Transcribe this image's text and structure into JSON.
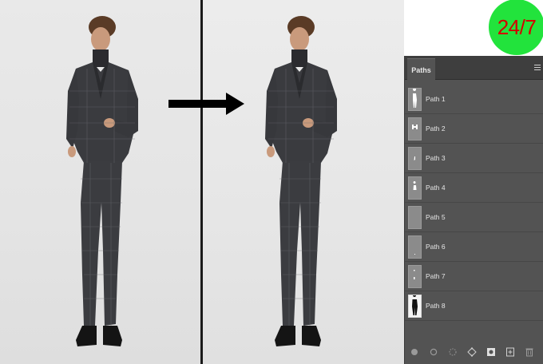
{
  "badge": {
    "text": "24/7",
    "color": "#22e33c",
    "text_color": "#d40000"
  },
  "panel": {
    "tab_label": "Paths",
    "paths": [
      {
        "label": "Path 1",
        "thumb": "figure-icon"
      },
      {
        "label": "Path 2",
        "thumb": "hands-icon"
      },
      {
        "label": "Path 3",
        "thumb": "dot-icon"
      },
      {
        "label": "Path 4",
        "thumb": "figure-icon"
      },
      {
        "label": "Path 5",
        "thumb": "empty"
      },
      {
        "label": "Path 6",
        "thumb": "empty"
      },
      {
        "label": "Path 7",
        "thumb": "dot-icon"
      },
      {
        "label": "Path 8",
        "thumb": "figure-mask-icon"
      }
    ],
    "footer_icons": [
      "fill-path-icon",
      "stroke-path-icon",
      "load-selection-icon",
      "make-work-path-icon",
      "add-mask-icon",
      "new-path-icon",
      "delete-icon"
    ]
  },
  "images": {
    "before": "model-photo-before",
    "after": "model-photo-after"
  }
}
